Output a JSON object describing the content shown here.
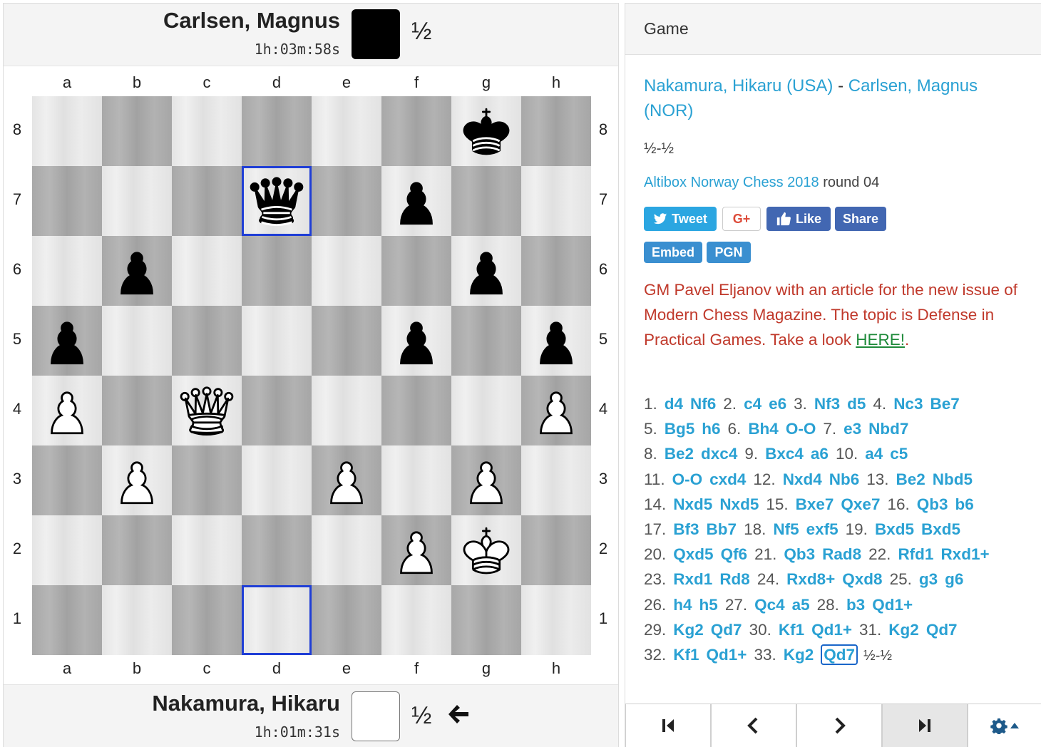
{
  "top_player": {
    "name": "Carlsen, Magnus",
    "clock": "1h:03m:58s",
    "score": "½",
    "color": "black"
  },
  "bottom_player": {
    "name": "Nakamura, Hikaru",
    "clock": "1h:01m:31s",
    "score": "½",
    "color": "white",
    "to_move": true
  },
  "files": [
    "a",
    "b",
    "c",
    "d",
    "e",
    "f",
    "g",
    "h"
  ],
  "ranks": [
    "8",
    "7",
    "6",
    "5",
    "4",
    "3",
    "2",
    "1"
  ],
  "board_fen_rows": [
    "......k.",
    "...q.p..",
    ".p....p.",
    "p....p.p",
    "P.Q....P",
    ".P..P.P.",
    ".....PK.",
    "........"
  ],
  "highlighted_squares": [
    "d7",
    "d1"
  ],
  "game": {
    "tab_label": "Game",
    "white": "Nakamura, Hikaru (USA)",
    "separator": " - ",
    "black": "Carlsen, Magnus (NOR)",
    "result": "½-½",
    "event": "Altibox Norway Chess 2018",
    "round": "round 04",
    "social": {
      "tweet": "Tweet",
      "gplus": "G+",
      "like": "Like",
      "share": "Share"
    },
    "embed": "Embed",
    "pgn": "PGN",
    "promo_text": "GM Pavel Eljanov with an article for the new issue of Modern Chess Magazine. The topic is Defense in Practical Games. Take a look ",
    "promo_link": "HERE!",
    "promo_end": ".",
    "current_move": "32...Qd7",
    "moves": [
      [
        "d4",
        "Nf6"
      ],
      [
        "c4",
        "e6"
      ],
      [
        "Nf3",
        "d5"
      ],
      [
        "Nc3",
        "Be7"
      ],
      [
        "Bg5",
        "h6"
      ],
      [
        "Bh4",
        "O-O"
      ],
      [
        "e3",
        "Nbd7"
      ],
      [
        "Be2",
        "dxc4"
      ],
      [
        "Bxc4",
        "a6"
      ],
      [
        "a4",
        "c5"
      ],
      [
        "O-O",
        "cxd4"
      ],
      [
        "Nxd4",
        "Nb6"
      ],
      [
        "Be2",
        "Nbd5"
      ],
      [
        "Nxd5",
        "Nxd5"
      ],
      [
        "Bxe7",
        "Qxe7"
      ],
      [
        "Qb3",
        "b6"
      ],
      [
        "Bf3",
        "Bb7"
      ],
      [
        "Nf5",
        "exf5"
      ],
      [
        "Bxd5",
        "Bxd5"
      ],
      [
        "Qxd5",
        "Qf6"
      ],
      [
        "Qb3",
        "Rad8"
      ],
      [
        "Rfd1",
        "Rxd1+"
      ],
      [
        "Rxd1",
        "Rd8"
      ],
      [
        "Rxd8+",
        "Qxd8"
      ],
      [
        "g3",
        "g6"
      ],
      [
        "h4",
        "h5"
      ],
      [
        "Qc4",
        "a5"
      ],
      [
        "b3",
        "Qd1+"
      ],
      [
        "Kg2",
        "Qd7"
      ],
      [
        "Kf1",
        "Qd1+"
      ],
      [
        "Kg2",
        "Qd7"
      ],
      [
        "Kf1",
        "Qd1+"
      ],
      [
        "Kg2",
        "Qd7"
      ]
    ],
    "move_rows": [
      [
        1,
        4
      ],
      [
        5,
        7
      ],
      [
        8,
        10
      ],
      [
        11,
        13
      ],
      [
        14,
        16
      ],
      [
        17,
        19
      ],
      [
        20,
        22
      ],
      [
        23,
        25
      ],
      [
        26,
        28
      ],
      [
        29,
        31
      ],
      [
        32,
        33
      ]
    ]
  },
  "nav": [
    "first-move",
    "previous-move",
    "next-move",
    "last-move",
    "settings"
  ],
  "colors": {
    "link": "#2aa1d3",
    "highlight": "#1f3ed6",
    "promo": "#c0392b",
    "promo_link": "#1e8a3a"
  }
}
